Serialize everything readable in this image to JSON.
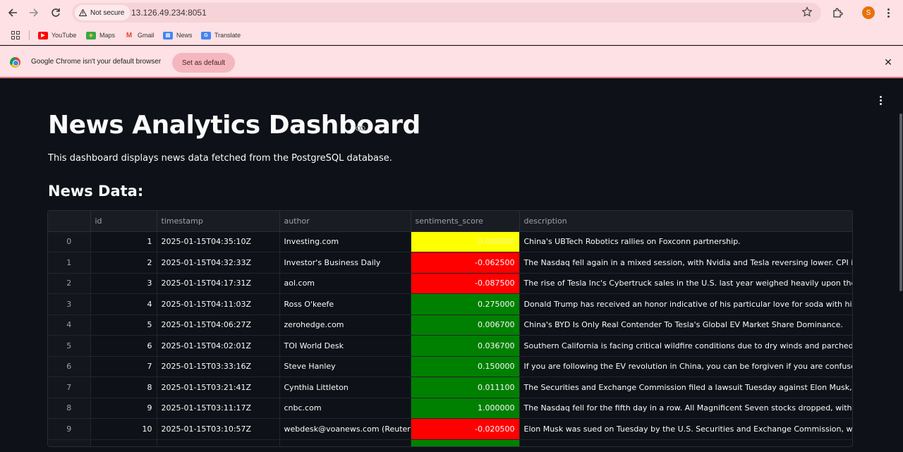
{
  "browser": {
    "security_label": "Not secure",
    "url": "13.126.49.234:8051",
    "profile_initial": "S"
  },
  "bookmarks": [
    {
      "label": "YouTube",
      "icon": "youtube-icon",
      "color": "#ff0000"
    },
    {
      "label": "Maps",
      "icon": "maps-icon",
      "color": "#34a853"
    },
    {
      "label": "Gmail",
      "icon": "gmail-icon",
      "color": "#ea4335"
    },
    {
      "label": "News",
      "icon": "news-icon",
      "color": "#4285f4"
    },
    {
      "label": "Translate",
      "icon": "translate-icon",
      "color": "#4285f4"
    }
  ],
  "infobar": {
    "message": "Google Chrome isn't your default browser",
    "button": "Set as default"
  },
  "page": {
    "title": "News Analytics Dashboard",
    "subtitle": "This dashboard displays news data fetched from the PostgreSQL database.",
    "section_heading": "News Data:"
  },
  "table": {
    "columns": [
      "",
      "id",
      "timestamp",
      "author",
      "sentiments_score",
      "description"
    ],
    "rows": [
      {
        "index": "0",
        "id": "1",
        "timestamp": "2025-01-15T04:35:10Z",
        "author": "Investing.com",
        "score": "0.000000",
        "score_color": "#ffff00",
        "description": "China's UBTech Robotics rallies on Foxconn partnership."
      },
      {
        "index": "1",
        "id": "2",
        "timestamp": "2025-01-15T04:32:33Z",
        "author": "Investor's Business Daily",
        "score": "-0.062500",
        "score_color": "#ff0000",
        "description": "The Nasdaq fell again in a mixed session, with Nvidia and Tesla reversing lower. CPI inflation is d"
      },
      {
        "index": "2",
        "id": "3",
        "timestamp": "2025-01-15T04:17:31Z",
        "author": "aol.com",
        "score": "-0.087500",
        "score_color": "#ff0000",
        "description": "The rise of Tesla Inc's Cybertruck sales in the U.S. last year weighed heavily upon the company's"
      },
      {
        "index": "3",
        "id": "4",
        "timestamp": "2025-01-15T04:11:03Z",
        "author": "Ross O'keefe",
        "score": "0.275000",
        "score_color": "#008000",
        "description": "Donald Trump has received an honor indicative of his particular love for soda with his inaugurat"
      },
      {
        "index": "4",
        "id": "5",
        "timestamp": "2025-01-15T04:06:27Z",
        "author": "zerohedge.com",
        "score": "0.006700",
        "score_color": "#008000",
        "description": "China's BYD Is Only Real Contender To Tesla's Global EV Market Share Dominance."
      },
      {
        "index": "5",
        "id": "6",
        "timestamp": "2025-01-15T04:02:01Z",
        "author": "TOI World Desk",
        "score": "0.036700",
        "score_color": "#008000",
        "description": "Southern California is facing critical wildfire conditions due to dry winds and parched terrain. W"
      },
      {
        "index": "6",
        "id": "7",
        "timestamp": "2025-01-15T03:33:16Z",
        "author": "Steve Hanley",
        "score": "0.150000",
        "score_color": "#008000",
        "description": "If you are following the EV revolution in China, you can be forgiven if you are confused. The lates"
      },
      {
        "index": "7",
        "id": "8",
        "timestamp": "2025-01-15T03:21:41Z",
        "author": "Cynthia Littleton",
        "score": "0.011100",
        "score_color": "#008000",
        "description": "The Securities and Exchange Commission filed a lawsuit Tuesday against Elon Musk, accusing th"
      },
      {
        "index": "8",
        "id": "9",
        "timestamp": "2025-01-15T03:11:17Z",
        "author": "cnbc.com",
        "score": "1.000000",
        "score_color": "#008000",
        "description": "The Nasdaq fell for the fifth day in a row. All Magnificent Seven stocks dropped, with Meta, Tesla"
      },
      {
        "index": "9",
        "id": "10",
        "timestamp": "2025-01-15T03:10:57Z",
        "author": "webdesk@voanews.com (Reuters)",
        "score": "-0.020500",
        "score_color": "#ff0000",
        "description": "Elon Musk was sued on Tuesday by the U.S. Securities and Exchange Commission, which accuse"
      },
      {
        "index": "",
        "id": "",
        "timestamp": "",
        "author": "",
        "score": "",
        "score_color": "#008000",
        "description": ""
      }
    ]
  }
}
